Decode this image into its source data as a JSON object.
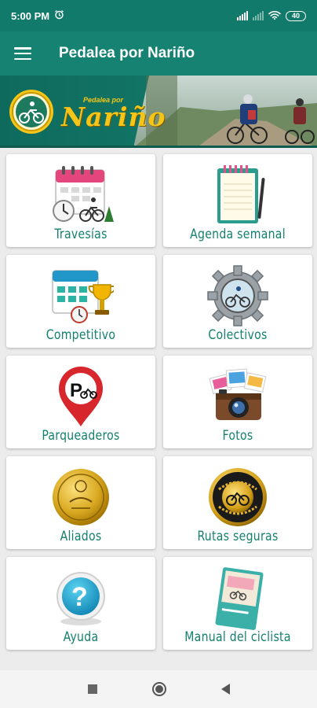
{
  "status_bar": {
    "time": "5:00 PM",
    "battery": "40"
  },
  "app_bar": {
    "title": "Pedalea por Nariño"
  },
  "banner": {
    "brand_small": "Pedalea por",
    "brand_main": "Nariño"
  },
  "menu": {
    "items": [
      {
        "label": "Travesías",
        "icon": "calendar-cycling-icon"
      },
      {
        "label": "Agenda semanal",
        "icon": "notepad-icon"
      },
      {
        "label": "Competitivo",
        "icon": "calendar-trophy-icon"
      },
      {
        "label": "Colectivos",
        "icon": "gear-group-icon"
      },
      {
        "label": "Parqueaderos",
        "icon": "parking-pin-icon"
      },
      {
        "label": "Fotos",
        "icon": "camera-photos-icon"
      },
      {
        "label": "Aliados",
        "icon": "gold-badge-icon"
      },
      {
        "label": "Rutas seguras",
        "icon": "ciclistas-unidos-badge-icon"
      },
      {
        "label": "Ayuda",
        "icon": "help-question-icon"
      },
      {
        "label": "Manual del ciclista",
        "icon": "manual-book-icon"
      }
    ]
  },
  "colors": {
    "primary": "#168372",
    "status": "#127a6a",
    "label": "#14806f",
    "accent": "#f5c518"
  }
}
